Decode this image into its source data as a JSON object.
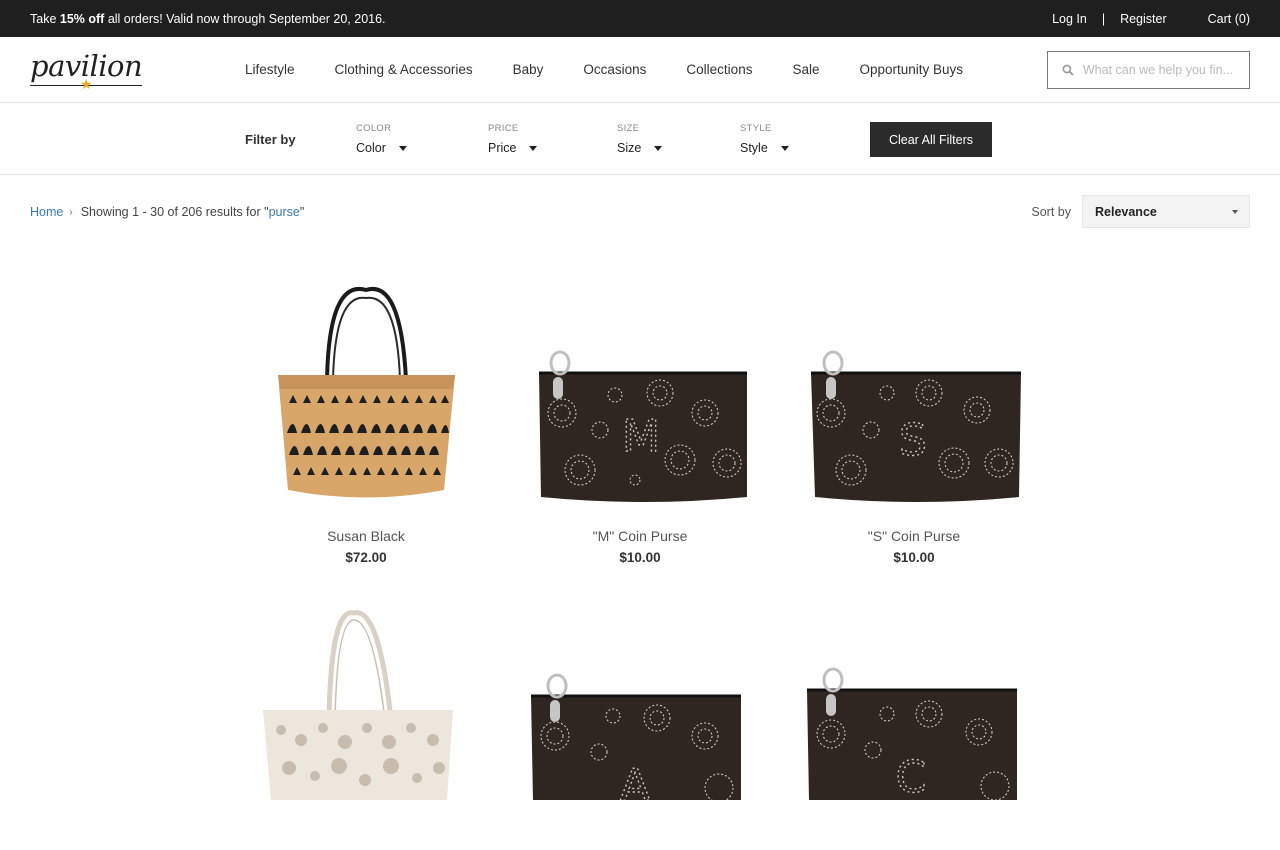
{
  "promo": {
    "prefix": "Take ",
    "bold": "15% off",
    "suffix": " all orders! Valid now through September 20, 2016.",
    "login": "Log In",
    "separator": "|",
    "register": "Register",
    "cart": "Cart (0)"
  },
  "header": {
    "logo_text": "pavilion",
    "nav": [
      "Lifestyle",
      "Clothing & Accessories",
      "Baby",
      "Occasions",
      "Collections",
      "Sale",
      "Opportunity Buys"
    ],
    "search_placeholder": "What can we help you fin..."
  },
  "filters": {
    "label": "Filter by",
    "items": [
      {
        "caption": "COLOR",
        "value": "Color"
      },
      {
        "caption": "PRICE",
        "value": "Price"
      },
      {
        "caption": "SIZE",
        "value": "Size"
      },
      {
        "caption": "STYLE",
        "value": "Style"
      }
    ],
    "clear": "Clear All Filters"
  },
  "results": {
    "home": "Home",
    "showing": "Showing 1 - 30 of 206 results for \"",
    "query": "purse",
    "close_quote": "\"",
    "sort_label": "Sort by",
    "sort_value": "Relevance"
  },
  "products": [
    {
      "name": "Susan Black",
      "price": "$72.00"
    },
    {
      "name": "\"M\" Coin Purse",
      "price": "$10.00"
    },
    {
      "name": "\"S\" Coin Purse",
      "price": "$10.00"
    },
    {
      "name": "",
      "price": ""
    },
    {
      "name": "",
      "price": ""
    },
    {
      "name": "",
      "price": ""
    }
  ],
  "colors": {
    "promo_bg": "#1f1f1f",
    "link": "#3a79b8",
    "button_bg": "#2b2b2b",
    "logo_star": "#e8a91c"
  }
}
